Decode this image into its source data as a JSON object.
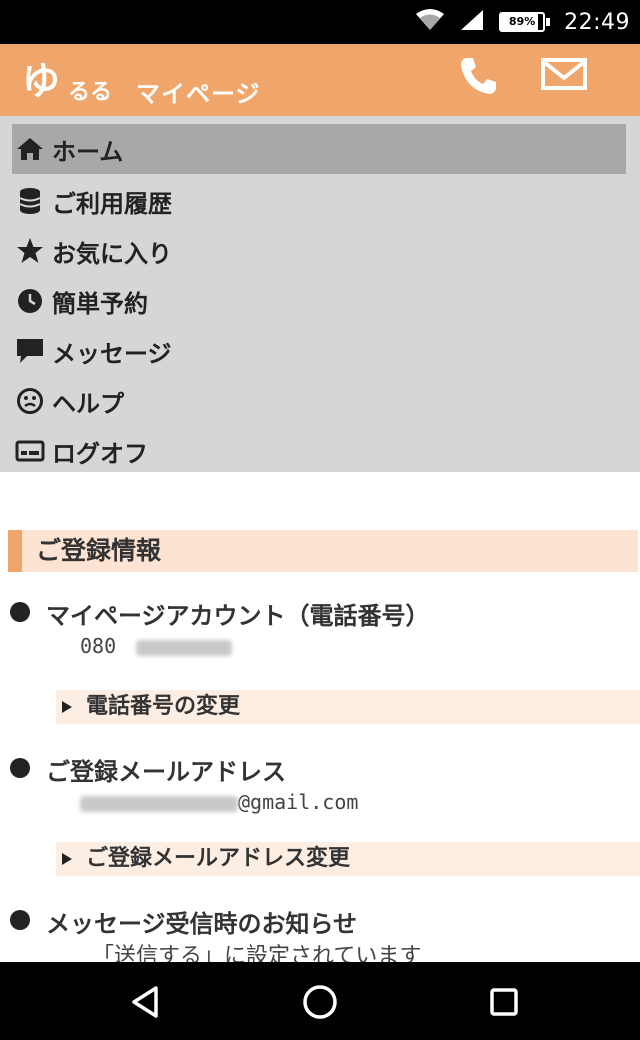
{
  "status_bar": {
    "battery_percent": 89,
    "battery_label": "89%",
    "time": "22:49"
  },
  "header": {
    "logo_mark": "ゆ",
    "logo_sub": "るる",
    "title": "マイページ",
    "accent_color": "#f0a66a",
    "icons": [
      "phone-icon",
      "mail-icon"
    ]
  },
  "nav": {
    "items": [
      {
        "label": "ホーム",
        "icon": "home-icon",
        "active": true
      },
      {
        "label": "ご利用履歴",
        "icon": "database-icon",
        "active": false
      },
      {
        "label": "お気に入り",
        "icon": "star-icon",
        "active": false
      },
      {
        "label": "簡単予約",
        "icon": "clock-icon",
        "active": false
      },
      {
        "label": "メッセージ",
        "icon": "chat-icon",
        "active": false
      },
      {
        "label": "ヘルプ",
        "icon": "help-face-icon",
        "active": false
      },
      {
        "label": "ログオフ",
        "icon": "card-icon",
        "active": false
      }
    ]
  },
  "registration": {
    "section_title": "ご登録情報",
    "account_label": "マイページアカウント（電話番号）",
    "phone_prefix": "080",
    "change_phone_link": "電話番号の変更",
    "email_label": "ご登録メールアドレス",
    "email_suffix": "@gmail.com",
    "change_email_link": "ご登録メールアドレス変更",
    "notification_label": "メッセージ受信時のお知らせ",
    "notification_status": "「送信する」に設定されています"
  },
  "system_nav": {
    "icons": [
      "back-icon",
      "home-nav-icon",
      "recents-icon"
    ]
  }
}
